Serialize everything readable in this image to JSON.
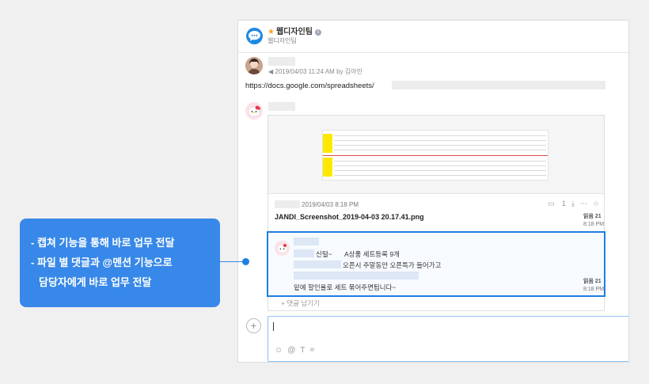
{
  "room": {
    "title": "웹디자인팀",
    "info_glyph": "i",
    "subtitle": "웹디자인팀"
  },
  "message1": {
    "meta": "◀ 2019/04/03 11:24 AM by 김아인",
    "url": "https://docs.google.com/spreadsheets/"
  },
  "file": {
    "meta": "2019/04/03 8:18 PM",
    "name": "JANDI_Screenshot_2019-04-03 20.17.41.png",
    "comment_count": "1",
    "icons": {
      "comment": "comment-icon",
      "download": "download-icon",
      "more": "more-icon",
      "star": "star-icon"
    }
  },
  "read_status": [
    {
      "label": "읽음 21",
      "time": "8:18 PM"
    },
    {
      "label": "읽음 21",
      "time": "8:18 PM"
    }
  ],
  "comment": {
    "line1_prefix": "신털~",
    "line1_text": "A상품 세트등록 9개",
    "line2_text": "오픈시 주말동안 오픈특가 들어가고",
    "line3_text": "밑에 할인율로 세트 묶어주면됩니다~"
  },
  "reply_label": "+ 댓글 남기기",
  "composer": {
    "plus": "+",
    "tools": [
      "☺",
      "@",
      "T",
      "⌗"
    ]
  },
  "callout": {
    "lines": [
      "- 캡쳐 기능을 통해 바로 업무 전달",
      "- 파일 별 댓글과 @멘션 기능으로",
      "  담당자에게 바로 업무 전달"
    ]
  },
  "colors": {
    "accent": "#1e7ee3",
    "callout": "#3788e8",
    "star": "#f5a623"
  }
}
